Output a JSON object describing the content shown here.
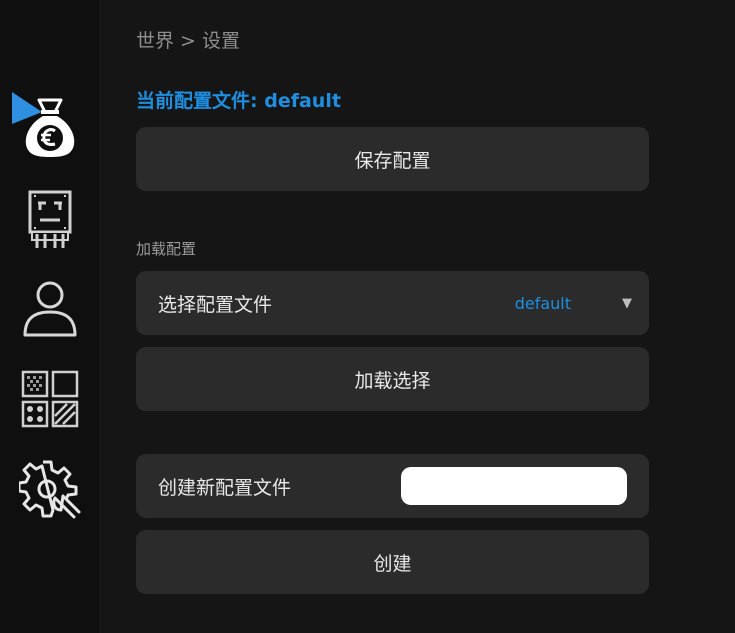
{
  "breadcrumb": "世界 > 设置",
  "current_profile": {
    "label": "当前配置文件:",
    "value": "default"
  },
  "save_button": "保存配置",
  "load_section": {
    "title": "加载配置",
    "select_label": "选择配置文件",
    "select_value": "default",
    "arrow": "▼",
    "load_button": "加载选择"
  },
  "create_section": {
    "label": "创建新配置文件",
    "input_value": "",
    "button": "创建"
  },
  "sidebar": {
    "items": [
      {
        "name": "money-bag-euro-icon",
        "active": true
      },
      {
        "name": "chip-icon",
        "active": false
      },
      {
        "name": "user-icon",
        "active": false
      },
      {
        "name": "texture-grid-icon",
        "active": false
      },
      {
        "name": "settings-gear-wrench-icon",
        "active": false
      }
    ]
  },
  "colors": {
    "accent": "#1e8fe0",
    "background": "#151515",
    "sidebar": "#0f0f0f",
    "card": "#2b2b2b"
  }
}
